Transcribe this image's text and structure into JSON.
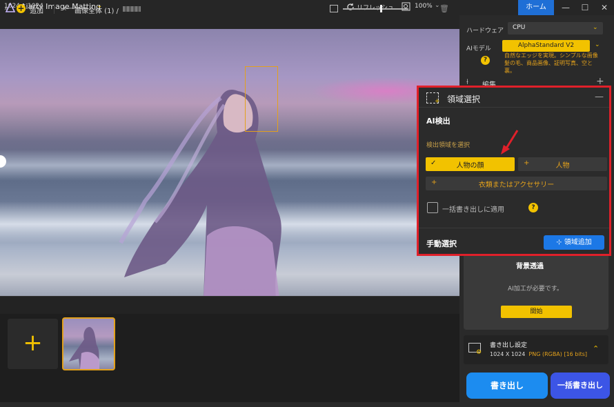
{
  "titlebar": {
    "app_title": "Aiarty Image Matting",
    "home_label": "ホーム",
    "minimize_glyph": "—",
    "maximize_glyph": "☐",
    "close_glyph": "✕"
  },
  "canvas_toolbar": {
    "dimensions": "1024 x 1024",
    "refresh_label": "リフレッシュ",
    "zoom_level": "100%"
  },
  "strip": {
    "add_label": "追加",
    "breadcrumb": "画像全体 (1)  /"
  },
  "settings": {
    "hardware_label": "ハードウェア",
    "hardware_value": "CPU",
    "ai_model_label": "AIモデル",
    "ai_model_value": "AlphaStandard  V2",
    "ai_model_desc": "自然なエッジを実現。シンプルな画像\n髪の毛、商品画像、証明写真、空と裏。",
    "edit_label": "編集"
  },
  "region_popup": {
    "title": "領域選択",
    "ai_detect_heading": "AI検出",
    "detect_area_label": "検出領域を選択",
    "options": {
      "face": "人物の顔",
      "person": "人物",
      "clothing": "衣類またはアクセサリー"
    },
    "batch_apply_label": "一括書き出しに適用",
    "manual_heading": "手動選択",
    "add_region_label": "⊹ 領域追加"
  },
  "background": {
    "title": "背景透過",
    "note": "AI加工が必要です。",
    "start_label": "開始"
  },
  "export": {
    "title": "書き出し設定",
    "size": "1024 X 1024",
    "format": "PNG (RGBA) [16 bits]",
    "export_label": "書き出し",
    "batch_export_label": "一括書き出し"
  },
  "colors": {
    "accent": "#f2c200",
    "highlight_border": "#e0202a",
    "primary_blue": "#1c8cf0"
  }
}
